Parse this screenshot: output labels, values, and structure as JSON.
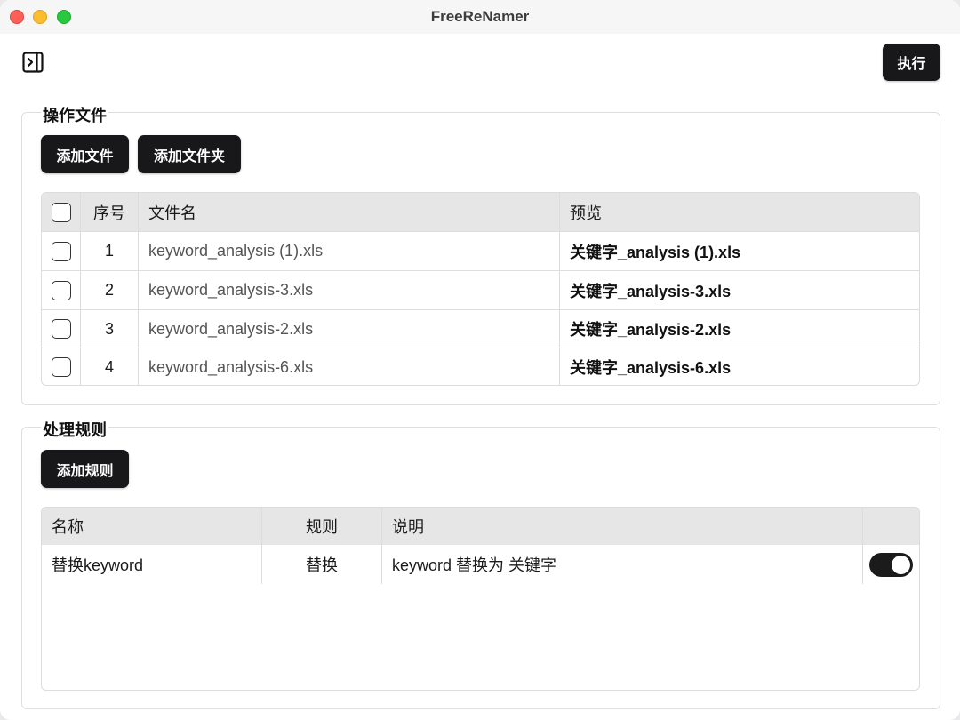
{
  "window": {
    "title": "FreeReNamer"
  },
  "toolbar": {
    "execute_label": "执行"
  },
  "files_panel": {
    "title": "操作文件",
    "add_file_label": "添加文件",
    "add_folder_label": "添加文件夹",
    "columns": {
      "index": "序号",
      "filename": "文件名",
      "preview": "预览"
    },
    "rows": [
      {
        "index": "1",
        "filename": "keyword_analysis (1).xls",
        "preview": "关键字_analysis (1).xls",
        "checked": false
      },
      {
        "index": "2",
        "filename": "keyword_analysis-3.xls",
        "preview": "关键字_analysis-3.xls",
        "checked": false
      },
      {
        "index": "3",
        "filename": "keyword_analysis-2.xls",
        "preview": "关键字_analysis-2.xls",
        "checked": false
      },
      {
        "index": "4",
        "filename": "keyword_analysis-6.xls",
        "preview": "关键字_analysis-6.xls",
        "checked": false
      }
    ]
  },
  "rules_panel": {
    "title": "处理规则",
    "add_rule_label": "添加规则",
    "columns": {
      "name": "名称",
      "rule": "规则",
      "description": "说明",
      "enabled": ""
    },
    "rows": [
      {
        "name": "替换keyword",
        "rule": "替换",
        "description": "keyword 替换为 关键字",
        "enabled": true
      }
    ]
  },
  "colors": {
    "button_bg": "#18181b",
    "header_bg": "#e6e6e6",
    "toggle_on": "#1b1b1b"
  },
  "icons": {
    "sidebar_toggle": "sidebar-toggle-icon"
  }
}
